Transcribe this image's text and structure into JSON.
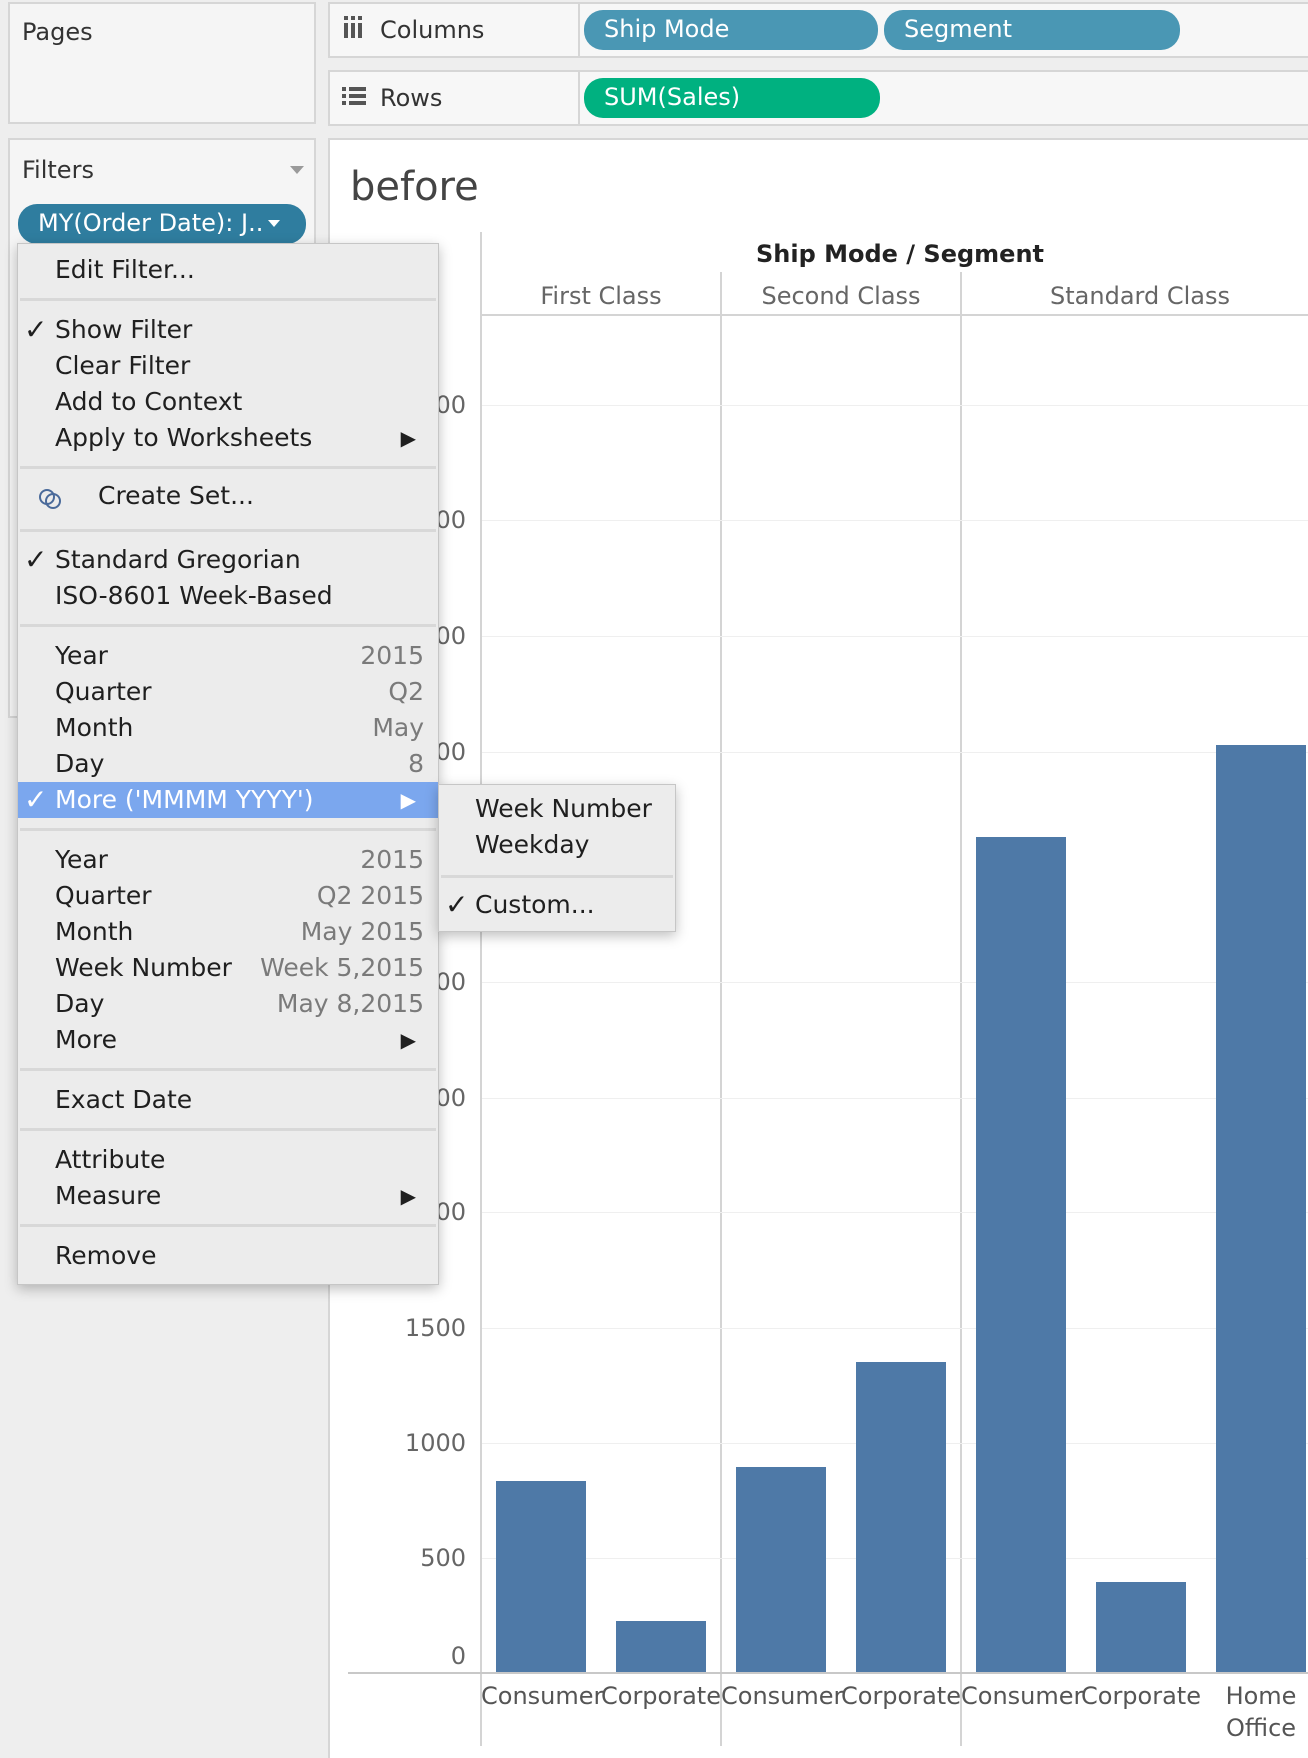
{
  "pages": {
    "title": "Pages"
  },
  "filters": {
    "title": "Filters",
    "pill": "MY(Order Date): J.."
  },
  "shelves": {
    "columns_label": "Columns",
    "rows_label": "Rows",
    "columns": [
      "Ship Mode",
      "Segment"
    ],
    "rows": [
      "SUM(Sales)"
    ]
  },
  "sheet": {
    "title": "before"
  },
  "context_menu": {
    "edit_filter": "Edit Filter...",
    "show_filter": "Show Filter",
    "clear_filter": "Clear Filter",
    "add_to_context": "Add to Context",
    "apply_to_worksheets": "Apply to Worksheets",
    "create_set": "Create Set...",
    "standard_gregorian": "Standard Gregorian",
    "iso_week": "ISO-8601 Week-Based",
    "discrete": [
      {
        "label": "Year",
        "value": "2015"
      },
      {
        "label": "Quarter",
        "value": "Q2"
      },
      {
        "label": "Month",
        "value": "May"
      },
      {
        "label": "Day",
        "value": "8"
      }
    ],
    "more_selected": "More ('MMMM YYYY')",
    "continuous": [
      {
        "label": "Year",
        "value": "2015"
      },
      {
        "label": "Quarter",
        "value": "Q2 2015"
      },
      {
        "label": "Month",
        "value": "May 2015"
      },
      {
        "label": "Week Number",
        "value": "Week 5,2015"
      },
      {
        "label": "Day",
        "value": "May 8,2015"
      }
    ],
    "more": "More",
    "exact_date": "Exact Date",
    "attribute": "Attribute",
    "measure": "Measure",
    "remove": "Remove"
  },
  "submenu": {
    "week_number": "Week Number",
    "weekday": "Weekday",
    "custom": "Custom..."
  },
  "colors": {
    "bar": "#4e79a7",
    "pill_blue": "#4a97b4",
    "pill_green": "#00b180",
    "menu_highlight": "#7ba7ee"
  },
  "chart_data": {
    "type": "bar",
    "header_title": "Ship Mode / Segment",
    "groups": [
      "First Class",
      "Second Class",
      "Standard Class"
    ],
    "categories": [
      "Consumer",
      "Corporate",
      "Consumer",
      "Corporate",
      "Consumer",
      "Corporate",
      "Home Office"
    ],
    "category_group": [
      "First Class",
      "First Class",
      "Second Class",
      "Second Class",
      "Standard Class",
      "Standard Class",
      "Standard Class"
    ],
    "values": [
      830,
      220,
      890,
      1350,
      3630,
      390,
      4030
    ],
    "y_ticks_visible": [
      "00",
      "00",
      "00",
      "00",
      "00",
      "00",
      "00",
      "1500",
      "1000",
      "500",
      "0"
    ],
    "ylim": [
      0,
      4500
    ],
    "grid": true
  }
}
